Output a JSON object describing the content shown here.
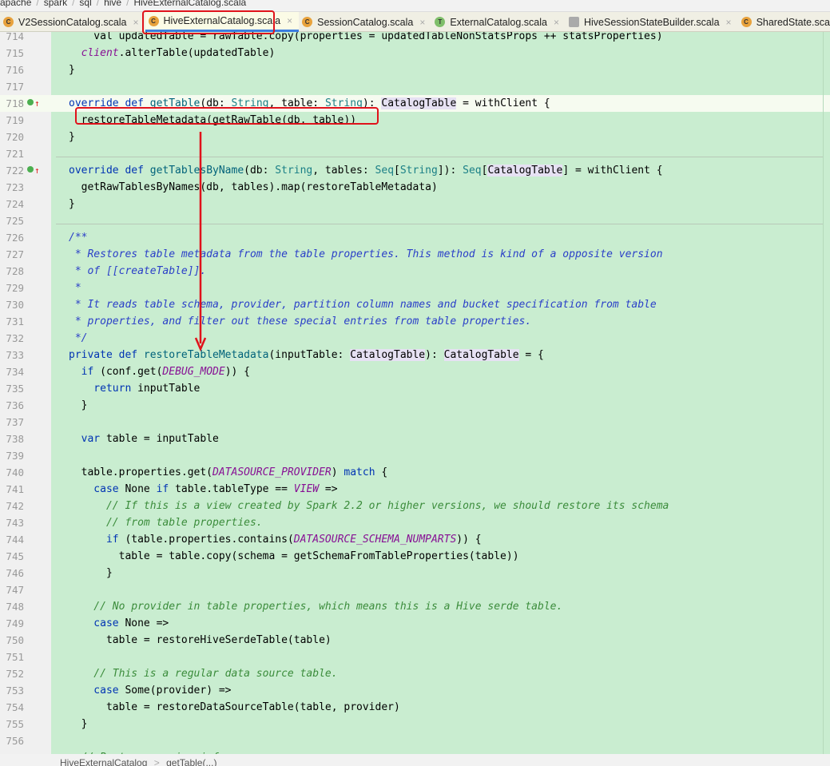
{
  "breadcrumb": [
    "apache",
    "spark",
    "sql",
    "hive",
    "HiveExternalCatalog.scala"
  ],
  "tabs": [
    {
      "label": "V2SessionCatalog.scala",
      "icon": "scala-class-icon",
      "color": "#e8a23c",
      "active": false
    },
    {
      "label": "HiveExternalCatalog.scala",
      "icon": "scala-class-icon",
      "color": "#e8a23c",
      "active": true
    },
    {
      "label": "SessionCatalog.scala",
      "icon": "scala-class-icon",
      "color": "#e8a23c",
      "active": false
    },
    {
      "label": "ExternalCatalog.scala",
      "icon": "scala-trait-icon",
      "color": "#7fbf6a",
      "active": false
    },
    {
      "label": "HiveSessionStateBuilder.scala",
      "icon": "scala-file-icon",
      "color": "#aaaaaa",
      "active": false
    },
    {
      "label": "SharedState.scala",
      "icon": "scala-class-icon",
      "color": "#e8a23c",
      "active": false
    }
  ],
  "code": [
    {
      "n": "714",
      "t": [
        [
          "",
          "    val updatedTable = rawTable.copy(properties = updatedTableNonStatsProps ++ statsProperties)"
        ]
      ]
    },
    {
      "n": "715",
      "t": [
        [
          "",
          "  "
        ],
        [
          "cn",
          "client"
        ],
        [
          "",
          ".alterTable(updatedTable)"
        ]
      ]
    },
    {
      "n": "716",
      "t": [
        [
          "",
          "}"
        ]
      ]
    },
    {
      "n": "717",
      "t": []
    },
    {
      "n": "718",
      "cur": true,
      "mark": true,
      "t": [
        [
          "kw",
          "override def "
        ],
        [
          "fn",
          "getTable"
        ],
        [
          "",
          "(db: "
        ],
        [
          "ty",
          "String"
        ],
        [
          "",
          ", table: "
        ],
        [
          "ty",
          "String"
        ],
        [
          "",
          "): "
        ],
        [
          "hl",
          "CatalogTable"
        ],
        [
          "",
          " = withClient {"
        ]
      ]
    },
    {
      "n": "719",
      "t": [
        [
          "",
          "  restoreTableMetadata(getRawTable(db, table))"
        ]
      ]
    },
    {
      "n": "720",
      "t": [
        [
          "",
          "}"
        ]
      ]
    },
    {
      "n": "721",
      "t": []
    },
    {
      "n": "722",
      "mark": true,
      "t": [
        [
          "kw",
          "override def "
        ],
        [
          "fn",
          "getTablesByName"
        ],
        [
          "",
          "(db: "
        ],
        [
          "ty",
          "String"
        ],
        [
          "",
          ", tables: "
        ],
        [
          "ty",
          "Seq"
        ],
        [
          "",
          "["
        ],
        [
          "ty",
          "String"
        ],
        [
          "",
          "]): "
        ],
        [
          "ty",
          "Seq"
        ],
        [
          "",
          "["
        ],
        [
          "hl",
          "CatalogTable"
        ],
        [
          "",
          "] = withClient {"
        ]
      ]
    },
    {
      "n": "723",
      "t": [
        [
          "",
          "  getRawTablesByNames(db, tables).map(restoreTableMetadata)"
        ]
      ]
    },
    {
      "n": "724",
      "t": [
        [
          "",
          "}"
        ]
      ]
    },
    {
      "n": "725",
      "t": []
    },
    {
      "n": "726",
      "t": [
        [
          "doc",
          "/**"
        ]
      ]
    },
    {
      "n": "727",
      "t": [
        [
          "doc",
          " * Restores table metadata from the table properties. This method is kind of a opposite version"
        ]
      ]
    },
    {
      "n": "728",
      "t": [
        [
          "doc",
          " * of [[createTable]]."
        ]
      ]
    },
    {
      "n": "729",
      "t": [
        [
          "doc",
          " *"
        ]
      ]
    },
    {
      "n": "730",
      "t": [
        [
          "doc",
          " * It reads table schema, provider, partition column names and bucket specification from table"
        ]
      ]
    },
    {
      "n": "731",
      "t": [
        [
          "doc",
          " * properties, and filter out these special entries from table properties."
        ]
      ]
    },
    {
      "n": "732",
      "t": [
        [
          "doc",
          " */"
        ]
      ]
    },
    {
      "n": "733",
      "t": [
        [
          "kw",
          "private def "
        ],
        [
          "fn",
          "restoreTableMetadata"
        ],
        [
          "",
          "(inputTable: "
        ],
        [
          "hl",
          "CatalogTable"
        ],
        [
          "",
          "): "
        ],
        [
          "hl",
          "CatalogTable"
        ],
        [
          "",
          " = {"
        ]
      ]
    },
    {
      "n": "734",
      "t": [
        [
          "kw",
          "  if "
        ],
        [
          "",
          "(conf.get("
        ],
        [
          "cn",
          "DEBUG_MODE"
        ],
        [
          "",
          ")) {"
        ]
      ]
    },
    {
      "n": "735",
      "t": [
        [
          "kw",
          "    return "
        ],
        [
          "",
          "inputTable"
        ]
      ]
    },
    {
      "n": "736",
      "t": [
        [
          "",
          "  }"
        ]
      ]
    },
    {
      "n": "737",
      "t": []
    },
    {
      "n": "738",
      "t": [
        [
          "kw",
          "  var "
        ],
        [
          "",
          "table = inputTable"
        ]
      ]
    },
    {
      "n": "739",
      "t": []
    },
    {
      "n": "740",
      "t": [
        [
          "",
          "  table.properties.get("
        ],
        [
          "cn",
          "DATASOURCE_PROVIDER"
        ],
        [
          "",
          ") "
        ],
        [
          "kw",
          "match"
        ],
        [
          "",
          " {"
        ]
      ]
    },
    {
      "n": "741",
      "t": [
        [
          "kw",
          "    case "
        ],
        [
          "",
          "None "
        ],
        [
          "kw",
          "if "
        ],
        [
          "",
          "table.tableType == "
        ],
        [
          "cn",
          "VIEW"
        ],
        [
          "",
          " =>"
        ]
      ]
    },
    {
      "n": "742",
      "t": [
        [
          "cm",
          "      // If this is a view created by Spark 2.2 or higher versions, we should restore its schema"
        ]
      ]
    },
    {
      "n": "743",
      "t": [
        [
          "cm",
          "      // from table properties."
        ]
      ]
    },
    {
      "n": "744",
      "t": [
        [
          "kw",
          "      if "
        ],
        [
          "",
          "(table.properties.contains("
        ],
        [
          "cn",
          "DATASOURCE_SCHEMA_NUMPARTS"
        ],
        [
          "",
          ")) {"
        ]
      ]
    },
    {
      "n": "745",
      "t": [
        [
          "",
          "        table = table.copy(schema = getSchemaFromTableProperties(table))"
        ]
      ]
    },
    {
      "n": "746",
      "t": [
        [
          "",
          "      }"
        ]
      ]
    },
    {
      "n": "747",
      "t": []
    },
    {
      "n": "748",
      "t": [
        [
          "cm",
          "    // No provider in table properties, which means this is a Hive serde table."
        ]
      ]
    },
    {
      "n": "749",
      "t": [
        [
          "kw",
          "    case "
        ],
        [
          "",
          "None =>"
        ]
      ]
    },
    {
      "n": "750",
      "t": [
        [
          "",
          "      table = restoreHiveSerdeTable(table)"
        ]
      ]
    },
    {
      "n": "751",
      "t": []
    },
    {
      "n": "752",
      "t": [
        [
          "cm",
          "    // This is a regular data source table."
        ]
      ]
    },
    {
      "n": "753",
      "t": [
        [
          "kw",
          "    case "
        ],
        [
          "",
          "Some(provider) =>"
        ]
      ]
    },
    {
      "n": "754",
      "t": [
        [
          "",
          "      table = restoreDataSourceTable(table, provider)"
        ]
      ]
    },
    {
      "n": "755",
      "t": [
        [
          "",
          "  }"
        ]
      ]
    },
    {
      "n": "756",
      "t": []
    },
    {
      "n": "757",
      "t": [
        [
          "cm",
          "  // Restore version info"
        ]
      ]
    }
  ],
  "footer": {
    "class": "HiveExternalCatalog",
    "sep": ">",
    "method": "getTable(...)"
  },
  "annotation_color": "#e0121b"
}
